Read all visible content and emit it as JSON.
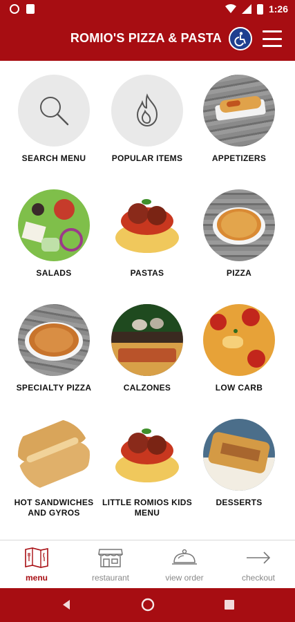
{
  "status_bar": {
    "time": "1:26"
  },
  "header": {
    "title": "ROMIO'S PIZZA & PASTA"
  },
  "tiles": [
    {
      "label": "SEARCH MENU",
      "icon": "search-icon"
    },
    {
      "label": "POPULAR ITEMS",
      "icon": "flame-icon"
    },
    {
      "label": "APPETIZERS"
    },
    {
      "label": "SALADS"
    },
    {
      "label": "PASTAS"
    },
    {
      "label": "PIZZA"
    },
    {
      "label": "SPECIALTY PIZZA"
    },
    {
      "label": "CALZONES"
    },
    {
      "label": "LOW CARB"
    },
    {
      "label": "HOT SANDWICHES AND GYROS"
    },
    {
      "label": "LITTLE ROMIOS KIDS MENU"
    },
    {
      "label": "DESSERTS"
    }
  ],
  "tabs": [
    {
      "label": "menu",
      "icon": "menu-map-icon",
      "active": true
    },
    {
      "label": "restaurant",
      "icon": "storefront-icon"
    },
    {
      "label": "view order",
      "icon": "cloche-icon"
    },
    {
      "label": "checkout",
      "icon": "arrow-right-icon"
    }
  ],
  "colors": {
    "brand": "#a70d12",
    "accessibility": "#1f3f8f"
  }
}
